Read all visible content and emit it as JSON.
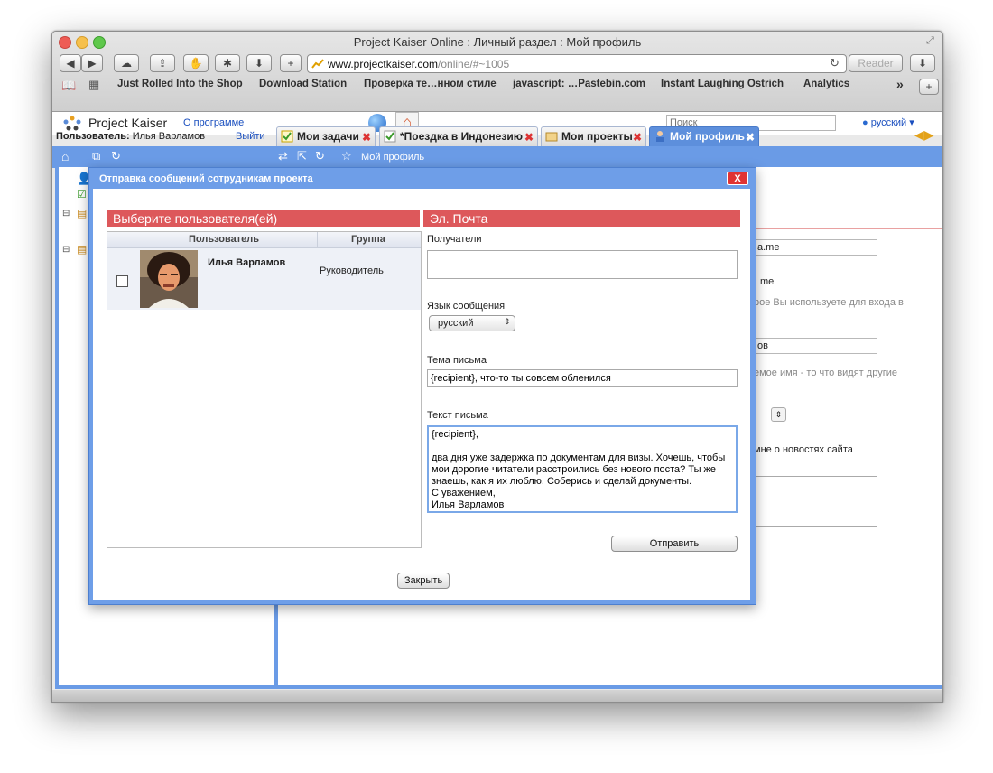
{
  "browser": {
    "window_title": "Project Kaiser Online : Личный раздел : Мой профиль",
    "url_host": "www.projectkaiser.com",
    "url_path": "/online/#~1005",
    "reader_label": "Reader",
    "bookmarks": [
      "Just Rolled Into the Shop",
      "Download Station",
      "Проверка те…нном стиле",
      "javascript: …Pastebin.com",
      "Instant Laughing Ostrich",
      "Analytics"
    ],
    "bookmarks_more": "»",
    "add_label": "+"
  },
  "app": {
    "logo_text": "Project Kaiser",
    "about_link": "О программе",
    "search_placeholder": "Поиск",
    "language": "русский",
    "user_label": "Пользователь:",
    "user_name": "Илья Варламов",
    "logout": "Выйти",
    "tabs": [
      {
        "label": "Мои задачи"
      },
      {
        "label": "*Поездка в Индонезию"
      },
      {
        "label": "Мои проекты"
      },
      {
        "label": "Мой профиль"
      }
    ],
    "toolbar_label": "Мой профиль"
  },
  "background_form": {
    "field1_value": "a.me",
    "text1": "me",
    "text2": "рое Вы используете для входа в",
    "field2_value": "ов",
    "text3": "емое имя - то что видят другие",
    "text4": "мне о новостях сайта"
  },
  "dialog": {
    "title": "Отправка сообщений сотрудникам проекта",
    "close_label": "X",
    "users_header": "Выберите пользователя(ей)",
    "col_user": "Пользователь",
    "col_group": "Группа",
    "rows": [
      {
        "name": "Илья Варламов",
        "group": "Руководитель"
      }
    ],
    "email_header": "Эл. Почта",
    "recipients_label": "Получатели",
    "recipients_value": "",
    "language_label": "Язык сообщения",
    "language_value": "русский",
    "subject_label": "Тема письма",
    "subject_value": "{recipient}, что-то ты совсем обленился",
    "body_label": "Текст письма",
    "body_value": "{recipient},\n\nдва дня уже задержка по документам для визы. Хочешь, чтобы мои дорогие читатели расстроились без нового поста? Ты же знаешь, как я их люблю. Соберись и сделай документы.\nС уважением,\nИлья Варламов",
    "send_label": "Отправить",
    "close_button_label": "Закрыть"
  },
  "colors": {
    "accent_blue": "#6a9be6",
    "section_red": "#dd585b",
    "close_red": "#e03333"
  }
}
